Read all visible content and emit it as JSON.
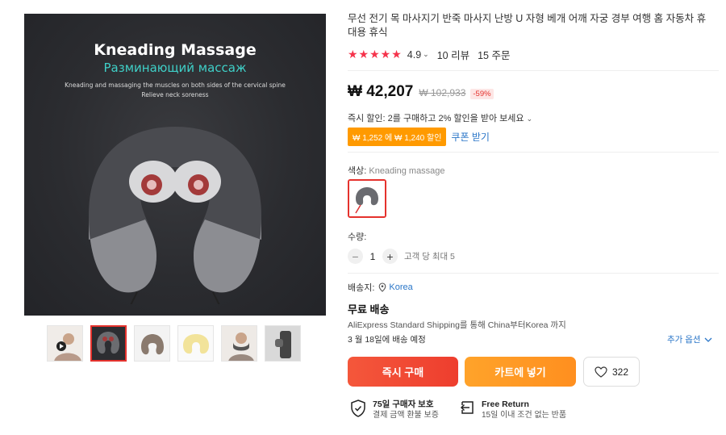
{
  "gallery": {
    "main_image": {
      "title": "Kneading Massage",
      "subtitle": "Разминающий массаж",
      "desc_line1": "Kneading and massaging the muscles on both sides of the cervical spine",
      "desc_line2": "Relieve neck soreness"
    },
    "thumbnails": [
      {
        "name": "thumb-1",
        "active": false
      },
      {
        "name": "thumb-2",
        "active": true
      },
      {
        "name": "thumb-3",
        "active": false
      },
      {
        "name": "thumb-4",
        "active": false
      },
      {
        "name": "thumb-5",
        "active": false
      },
      {
        "name": "thumb-6",
        "active": false
      }
    ]
  },
  "product": {
    "title": "무선 전기 목 마사지기 반죽 마사지 난방 U 자형 베개 어깨 자궁 경부 여행 홈 자동차 휴대용 휴식",
    "stars": "★★★★★",
    "rating": "4.9",
    "reviews": "10 리뷰",
    "orders": "15 주문"
  },
  "price": {
    "current": "₩ 42,207",
    "original": "₩ 102,933",
    "discount": "-59%"
  },
  "promo": {
    "instant": "즉시 할인: 2를 구매하고 2% 할인을 받아 보세요",
    "coupon_tag": "₩ 1,252 에 ₩ 1,240 할인",
    "coupon_link": "쿠폰 받기"
  },
  "variant": {
    "label": "색상:",
    "value": "Kneading massage"
  },
  "quantity": {
    "label": "수량:",
    "minus": "−",
    "value": "1",
    "plus": "+",
    "max_note": "고객 당 최대 5"
  },
  "shipping": {
    "to_label": "배송지:",
    "country": "Korea",
    "free": "무료 배송",
    "via": "AliExpress Standard Shipping를 통해 China부터Korea 까지",
    "eta": "3 월 18일에 배송 예정",
    "more_options": "추가 옵션"
  },
  "actions": {
    "buy_now": "즉시 구매",
    "add_to_cart": "카트에 넣기",
    "wishlist_count": "322"
  },
  "guarantees": [
    {
      "title": "75일 구매자 보호",
      "sub": "결제 금액 환불 보증"
    },
    {
      "title": "Free Return",
      "sub": "15일 이내 조건 없는 반품"
    }
  ],
  "colors": {
    "star_red": "#f5334b",
    "buy_orange_red": "#ee3e2e",
    "cart_orange": "#ff8f1f",
    "link_blue": "#2a76c8",
    "coupon_orange": "#ff9a00"
  }
}
